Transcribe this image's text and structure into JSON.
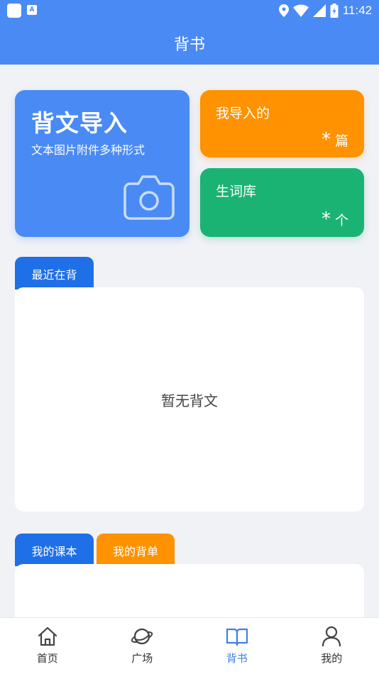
{
  "status_bar": {
    "time": "11:42",
    "notification_badge": "A"
  },
  "header": {
    "title": "背书"
  },
  "import_card": {
    "title": "背文导入",
    "subtitle": "文本图片附件多种形式",
    "icon": "camera-icon"
  },
  "my_imports_card": {
    "label": "我导入的",
    "count": "*",
    "unit": "篇"
  },
  "vocab_card": {
    "label": "生词库",
    "count": "*",
    "unit": "个"
  },
  "recent_section": {
    "tab_label": "最近在背",
    "empty_text": "暂无背文"
  },
  "course_section": {
    "tabs": [
      "我的课本",
      "我的背单"
    ]
  },
  "bottom_nav": {
    "items": [
      {
        "label": "首页",
        "icon": "home-icon",
        "active": false
      },
      {
        "label": "广场",
        "icon": "planet-icon",
        "active": false
      },
      {
        "label": "背书",
        "icon": "book-icon",
        "active": true
      },
      {
        "label": "我的",
        "icon": "user-icon",
        "active": false
      }
    ]
  },
  "colors": {
    "primary": "#4a8af4",
    "tab_blue": "#1e6fe8",
    "orange": "#fe9201",
    "green": "#1bb374",
    "background": "#f1f2f6",
    "nav_active": "#3f80e8"
  }
}
